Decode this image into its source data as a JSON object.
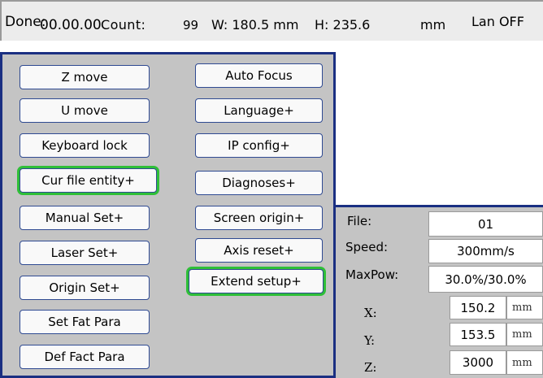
{
  "status_bar": {
    "done_label": "Done:",
    "done_value": "00.00.00",
    "count_label": "Count:",
    "count_value": "99",
    "width_text": "W: 180.5 mm",
    "height_text": "H: 235.6",
    "unit": "mm",
    "lan_status": "Lan OFF"
  },
  "menu": {
    "left": [
      "Z move",
      "U move",
      "Keyboard lock",
      "Cur file entity+",
      "Manual Set+",
      "Laser Set+",
      "Origin Set+",
      "Set Fat Para",
      "Def Fact Para"
    ],
    "right": [
      "Auto Focus",
      "Language+",
      "IP config+",
      "Diagnoses+",
      "Screen origin+",
      "Axis reset+",
      "Extend setup+"
    ]
  },
  "info": {
    "file_label": "File:",
    "file_value": "01",
    "speed_label": "Speed:",
    "speed_value": "300mm/s",
    "maxpow_label": "MaxPow:",
    "maxpow_value": "30.0%/30.0%",
    "x_label": "X:",
    "x_value": "150.2",
    "y_label": "Y:",
    "y_value": "153.5",
    "z_label": "Z:",
    "z_value": "3000",
    "coord_unit": "mm"
  },
  "colors": {
    "panel_border": "#1a2f82",
    "panel_bg": "#c4c4c4",
    "highlight": "#2fbf38"
  }
}
